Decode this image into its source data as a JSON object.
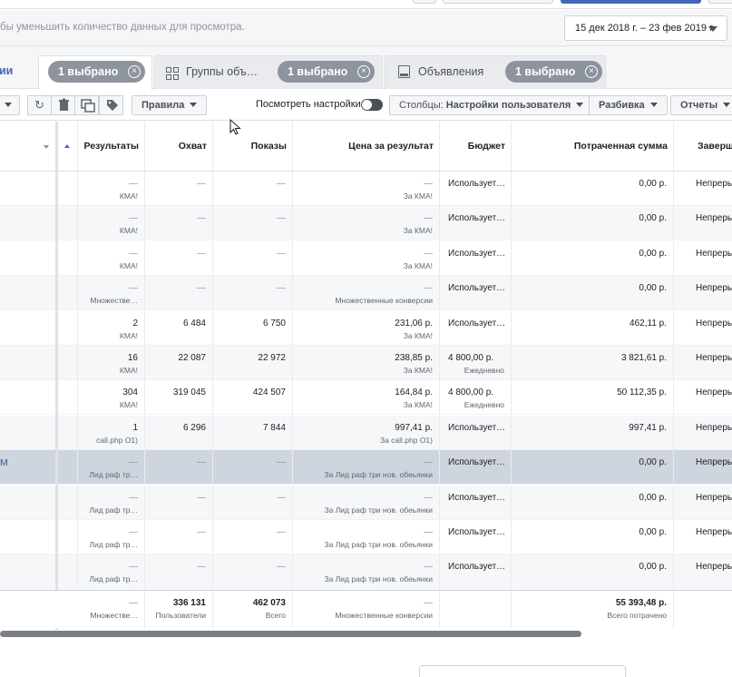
{
  "filter_bar": {
    "hint": "бы уменьшить количество данных для просмотра.",
    "date_range": "15 дек 2018 г. – 23 фев 2019 г."
  },
  "tabs": {
    "first_label": "ии",
    "items": [
      {
        "label": "",
        "pill": "1 выбрано"
      },
      {
        "label": "Группы объ…",
        "pill": "1 выбрано",
        "icon": "grid-icon"
      },
      {
        "label": "Объявления",
        "pill": "1 выбрано",
        "icon": "ad-icon"
      }
    ]
  },
  "toolbar": {
    "rules_label": "Правила",
    "settings_label": "Посмотреть настройки",
    "columns_prefix": "Столбцы:",
    "columns_value": "Настройки пользователя",
    "breakdown_label": "Разбивка",
    "reports_label": "Отчеты",
    "icons": [
      "refresh-icon",
      "trash-icon",
      "duplicate-icon",
      "tag-icon"
    ]
  },
  "table": {
    "headers": [
      "Результаты",
      "Охват",
      "Показы",
      "Цена за результат",
      "Бюджет",
      "Потраченная сумма",
      "Заверш"
    ],
    "rows": [
      {
        "name": "",
        "results": "—",
        "results_sub": "КМА!",
        "reach": "—",
        "impressions": "—",
        "cpr": "—",
        "cpr_sub": "За КМА!",
        "budget": "Использует…",
        "budget_sub": "",
        "spent": "0,00 р.",
        "end": "Непрерь"
      },
      {
        "name": "",
        "results": "—",
        "results_sub": "КМА!",
        "reach": "—",
        "impressions": "—",
        "cpr": "—",
        "cpr_sub": "За КМА!",
        "budget": "Использует…",
        "budget_sub": "",
        "spent": "0,00 р.",
        "end": "Непрерь"
      },
      {
        "name": "",
        "results": "—",
        "results_sub": "КМА!",
        "reach": "—",
        "impressions": "—",
        "cpr": "—",
        "cpr_sub": "За КМА!",
        "budget": "Использует…",
        "budget_sub": "",
        "spent": "0,00 р.",
        "end": "Непрерь"
      },
      {
        "name": "",
        "results": "—",
        "results_sub": "Множестве…",
        "reach": "—",
        "impressions": "—",
        "cpr": "—",
        "cpr_sub": "Множественные конверсии",
        "budget": "Использует…",
        "budget_sub": "",
        "spent": "0,00 р.",
        "end": "Непрерь"
      },
      {
        "name": "",
        "results": "2",
        "results_sub": "КМА!",
        "reach": "6 484",
        "impressions": "6 750",
        "cpr": "231,06 р.",
        "cpr_sub": "За КМА!",
        "budget": "Использует…",
        "budget_sub": "",
        "spent": "462,11 р.",
        "end": "Непрерь"
      },
      {
        "name": "",
        "results": "16",
        "results_sub": "КМА!",
        "reach": "22 087",
        "impressions": "22 972",
        "cpr": "238,85 р.",
        "cpr_sub": "За КМА!",
        "budget": "4 800,00 р.",
        "budget_sub": "Ежедневно",
        "spent": "3 821,61 р.",
        "end": "Непрерь"
      },
      {
        "name": "",
        "results": "304",
        "results_sub": "КМА!",
        "reach": "319 045",
        "impressions": "424 507",
        "cpr": "164,84 р.",
        "cpr_sub": "За КМА!",
        "budget": "4 800,00 р.",
        "budget_sub": "Ежедневно",
        "spent": "50 112,35 р.",
        "end": "Непрерь"
      },
      {
        "name": "",
        "results": "1",
        "results_sub": "call.php О1)",
        "reach": "6 296",
        "impressions": "7 844",
        "cpr": "997,41 р.",
        "cpr_sub": "За call.php О1)",
        "budget": "Использует…",
        "budget_sub": "",
        "spent": "997,41 р.",
        "end": "Непрерь"
      },
      {
        "name": "М",
        "results": "—",
        "results_sub": "Лид раф тр…",
        "reach": "—",
        "impressions": "—",
        "cpr": "—",
        "cpr_sub": "За Лид раф три нов. обеьянки",
        "budget": "Использует…",
        "budget_sub": "",
        "spent": "0,00 р.",
        "end": "Непрерь"
      },
      {
        "name": "",
        "results": "—",
        "results_sub": "Лид раф тр…",
        "reach": "—",
        "impressions": "—",
        "cpr": "—",
        "cpr_sub": "За Лид раф три нов. обеьянки",
        "budget": "Использует…",
        "budget_sub": "",
        "spent": "0,00 р.",
        "end": "Непрерь"
      },
      {
        "name": "",
        "results": "—",
        "results_sub": "Лид раф тр…",
        "reach": "—",
        "impressions": "—",
        "cpr": "—",
        "cpr_sub": "За Лид раф три нов. обеьянки",
        "budget": "Использует…",
        "budget_sub": "",
        "spent": "0,00 р.",
        "end": "Непрерь"
      },
      {
        "name": "",
        "results": "—",
        "results_sub": "Лид раф тр…",
        "reach": "—",
        "impressions": "—",
        "cpr": "—",
        "cpr_sub": "За Лид раф три нов. обеьянки",
        "budget": "Использует…",
        "budget_sub": "",
        "spent": "0,00 р.",
        "end": "Непрерь"
      }
    ],
    "totals": {
      "results": "—",
      "results_sub": "Множестве…",
      "reach": "336 131",
      "reach_sub": "Пользователи",
      "impressions": "462 073",
      "impressions_sub": "Всего",
      "cpr": "—",
      "cpr_sub": "Множественные конверсии",
      "spent": "55 393,48 р.",
      "spent_sub": "Всего потрачено"
    }
  }
}
